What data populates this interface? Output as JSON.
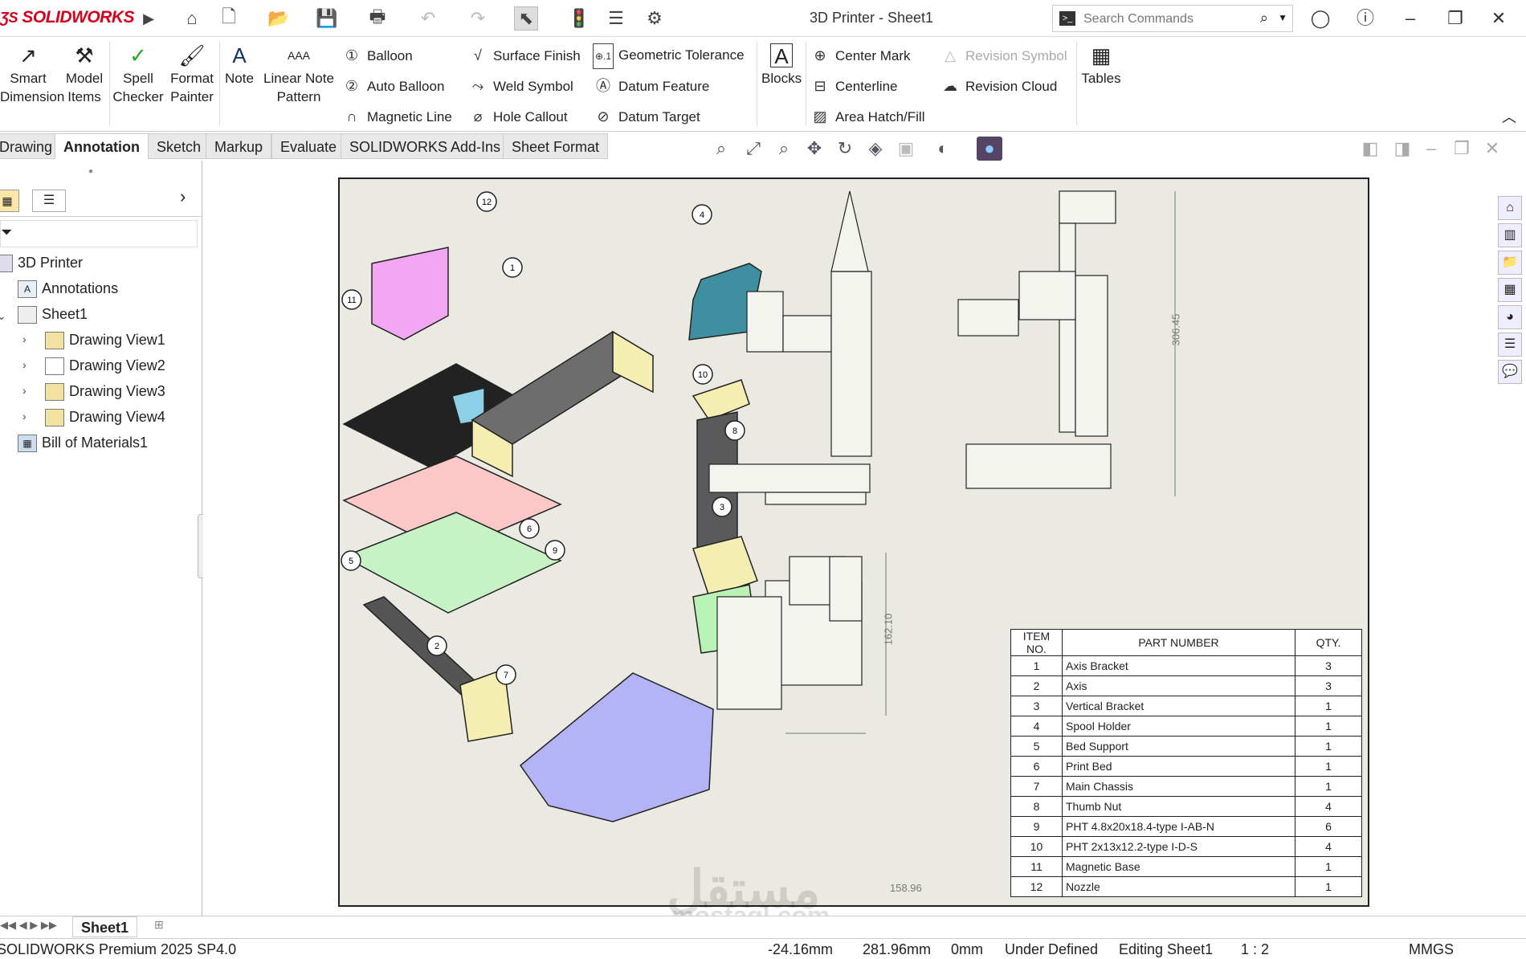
{
  "app": {
    "brand": "SOLIDWORKS",
    "window_title": "3D Printer - Sheet1",
    "accent": "#d6001c"
  },
  "search": {
    "placeholder": "Search Commands"
  },
  "ribbon": {
    "smart_dimension": "Smart\nDimension",
    "model_items": "Model\nItems",
    "spell_checker": "Spell\nChecker",
    "format_painter": "Format\nPainter",
    "note": "Note",
    "linear_note_pattern": "Linear Note\nPattern",
    "balloon": "Balloon",
    "auto_balloon": "Auto Balloon",
    "magnetic_line": "Magnetic Line",
    "surface_finish": "Surface Finish",
    "weld_symbol": "Weld Symbol",
    "hole_callout": "Hole Callout",
    "geometric_tolerance": "Geometric Tolerance",
    "datum_feature": "Datum Feature",
    "datum_target": "Datum Target",
    "blocks": "Blocks",
    "center_mark": "Center Mark",
    "centerline": "Centerline",
    "area_hatch": "Area Hatch/Fill",
    "revision_symbol": "Revision Symbol",
    "revision_cloud": "Revision Cloud",
    "tables": "Tables"
  },
  "tabs": [
    "Drawing",
    "Annotation",
    "Sketch",
    "Markup",
    "Evaluate",
    "SOLIDWORKS Add-Ins",
    "Sheet Format"
  ],
  "active_tab": "Annotation",
  "tree": {
    "root": "3D Printer",
    "annotations": "Annotations",
    "sheet": "Sheet1",
    "views": [
      "Drawing View1",
      "Drawing View2",
      "Drawing View3",
      "Drawing View4"
    ],
    "bom": "Bill of Materials1"
  },
  "bom": {
    "headers": [
      "ITEM NO.",
      "PART NUMBER",
      "QTY."
    ],
    "rows": [
      [
        "1",
        "Axis Bracket",
        "3"
      ],
      [
        "2",
        "Axis",
        "3"
      ],
      [
        "3",
        "Vertical Bracket",
        "1"
      ],
      [
        "4",
        "Spool Holder",
        "1"
      ],
      [
        "5",
        "Bed Support",
        "1"
      ],
      [
        "6",
        "Print Bed",
        "1"
      ],
      [
        "7",
        "Main Chassis",
        "1"
      ],
      [
        "8",
        "Thumb Nut",
        "4"
      ],
      [
        "9",
        "PHT 4.8x20x18.4-type I-AB-N",
        "6"
      ],
      [
        "10",
        "PHT 2x13x12.2-type I-D-S",
        "4"
      ],
      [
        "11",
        "Magnetic Base",
        "1"
      ],
      [
        "12",
        "Nozzle",
        "1"
      ]
    ]
  },
  "dimensions": {
    "height": "306.45",
    "height2": "162.10",
    "width": "158.96"
  },
  "balloons": [
    "12",
    "1",
    "11",
    "4",
    "8",
    "6",
    "5",
    "9",
    "2",
    "7",
    "3",
    "10"
  ],
  "sheet_tab": "Sheet1",
  "status": {
    "product": "SOLIDWORKS Premium 2025 SP4.0",
    "x": "-24.16mm",
    "y": "281.96mm",
    "z": "0mm",
    "state": "Under Defined",
    "editing": "Editing Sheet1",
    "scale": "1 : 2",
    "units": "MMGS"
  },
  "watermark": {
    "line1": "مستقل",
    "line2": "mostaql.com"
  }
}
